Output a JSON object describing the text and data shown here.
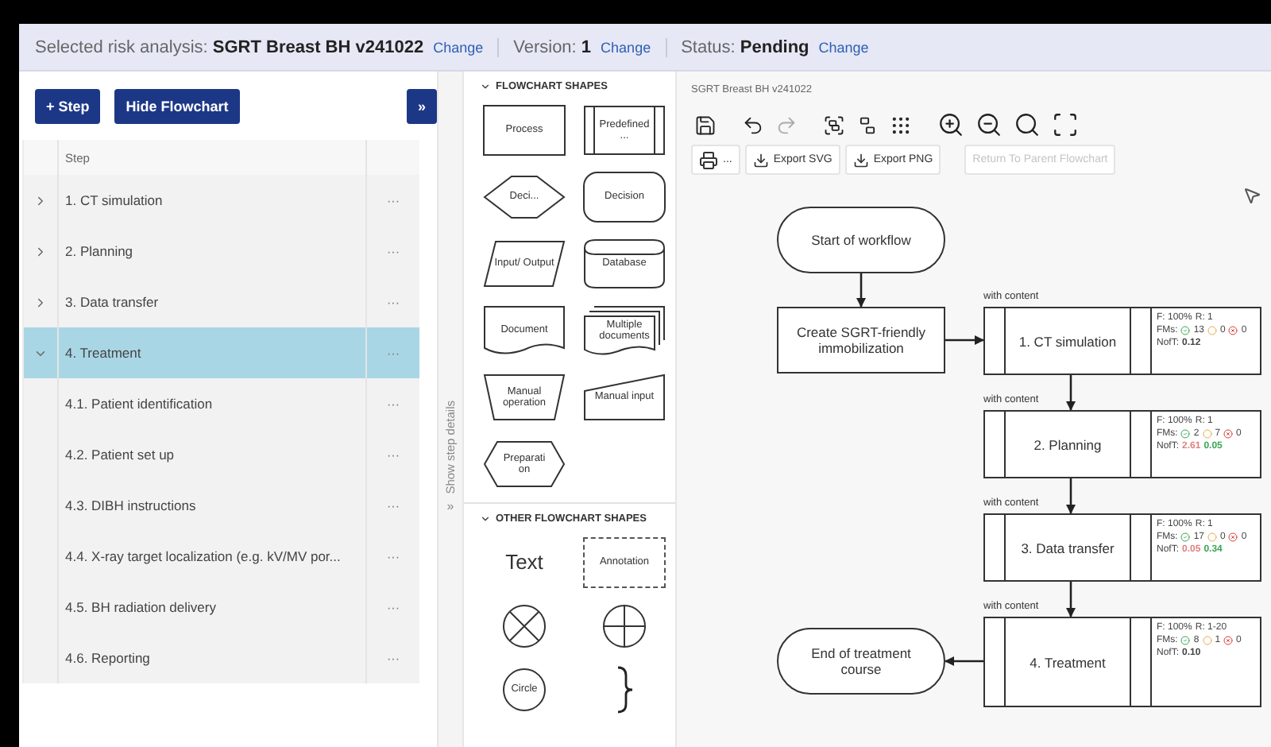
{
  "header": {
    "items": [
      {
        "label": "Selected risk analysis:",
        "value": "SGRT Breast BH v241022",
        "action": "Change"
      },
      {
        "label": "Version:",
        "value": "1",
        "action": "Change"
      },
      {
        "label": "Status:",
        "value": "Pending",
        "action": "Change"
      }
    ]
  },
  "left_panel": {
    "buttons": [
      "+ Step",
      "Hide Flowchart"
    ],
    "collapse_button": "»",
    "table": {
      "columns": [
        "Step"
      ],
      "rows": [
        {
          "label": "1. CT simulation",
          "menu": "···",
          "expanded": false,
          "selected": false
        },
        {
          "label": "2. Planning",
          "menu": "···",
          "expanded": false,
          "selected": false
        },
        {
          "label": "3. Data transfer",
          "menu": "···",
          "expanded": false,
          "selected": false
        },
        {
          "label": "4. Treatment",
          "menu": "···",
          "expanded": true,
          "selected": true,
          "children": [
            {
              "label": "4.1. Patient identification",
              "menu": "···",
              "selected": false
            },
            {
              "label": "4.2. Patient set up",
              "menu": "···",
              "selected": false
            },
            {
              "label": "4.3. DIBH instructions",
              "menu": "···",
              "selected": false
            },
            {
              "label": "4.4. X-ray target localization (e.g. kV/MV por...",
              "menu": "···",
              "selected": false
            },
            {
              "label": "4.5. BH radiation delivery",
              "menu": "···",
              "selected": false
            },
            {
              "label": "4.6. Reporting",
              "menu": "···",
              "selected": false
            }
          ]
        }
      ]
    }
  },
  "details_toggle": {
    "icon": "»",
    "label": "Show step details"
  },
  "shape_sections": [
    {
      "title": "FLOWCHART SHAPES",
      "expanded": true,
      "shapes": [
        {
          "kind": "process",
          "label": "Process"
        },
        {
          "kind": "predefined",
          "label": "Predefined ..."
        },
        {
          "kind": "diamond",
          "label": "Deci..."
        },
        {
          "kind": "rounded",
          "label": "Decision"
        },
        {
          "kind": "parallelogram",
          "label": "Input/ Output"
        },
        {
          "kind": "database",
          "label": "Database"
        },
        {
          "kind": "document",
          "label": "Document"
        },
        {
          "kind": "documents",
          "label": "Multiple documents"
        },
        {
          "kind": "manual_operation",
          "label": "Manual operation"
        },
        {
          "kind": "manual_input",
          "label": "Manual input"
        },
        {
          "kind": "hexagon",
          "label": "Preparation"
        }
      ]
    },
    {
      "title": "OTHER FLOWCHART SHAPES",
      "expanded": true,
      "shapes": [
        {
          "kind": "text",
          "label": "Text"
        },
        {
          "kind": "annotation",
          "label": "Annotation"
        },
        {
          "kind": "x_circle"
        },
        {
          "kind": "plus_circle"
        },
        {
          "kind": "circle",
          "label": "Circle"
        },
        {
          "kind": "brace"
        }
      ]
    }
  ],
  "canvas": {
    "title": "SGRT Breast BH v241022",
    "toolbar": [
      {
        "kind": "save",
        "disabled": false
      },
      {
        "kind": "undo",
        "disabled": false
      },
      {
        "kind": "redo",
        "disabled": true
      },
      {
        "kind": "group",
        "disabled": false
      },
      {
        "kind": "ungroup",
        "disabled": false
      },
      {
        "kind": "grid",
        "disabled": false
      },
      {
        "kind": "zoom_in",
        "disabled": false
      },
      {
        "kind": "zoom_out",
        "disabled": false
      },
      {
        "kind": "zoom_fit",
        "disabled": false
      },
      {
        "kind": "fullscreen",
        "disabled": false
      }
    ],
    "actions": [
      {
        "kind": "print",
        "label": "...",
        "disabled": false
      },
      {
        "kind": "download",
        "label": "Export SVG",
        "disabled": false
      },
      {
        "kind": "download",
        "label": "Export PNG",
        "disabled": false
      },
      {
        "kind": "plain",
        "label": "Return To Parent Flowchart",
        "disabled": true
      }
    ],
    "nodes": [
      {
        "kind": "terminal",
        "label": "Start of workflow"
      },
      {
        "kind": "process",
        "label": "Create SGRT-friendly immobilization"
      },
      {
        "kind": "step",
        "label": "1. CT simulation",
        "note": "with content",
        "f": "F: 100%",
        "r": "R: 1",
        "fms": "FMs:",
        "ok": "13",
        "warn": "0",
        "fail": "0",
        "noft_label": "NofT:",
        "noft": [
          {
            "value": "0.12",
            "color": "#444444"
          }
        ]
      },
      {
        "kind": "step",
        "label": "2. Planning",
        "note": "with content",
        "f": "F: 100%",
        "r": "R: 1",
        "fms": "FMs:",
        "ok": "2",
        "warn": "7",
        "fail": "0",
        "noft_label": "NofT:",
        "noft": [
          {
            "value": "2.61",
            "color": "#e08080"
          },
          {
            "value": "0.05",
            "color": "#3aa655"
          }
        ]
      },
      {
        "kind": "step",
        "label": "3. Data transfer",
        "note": "with content",
        "f": "F: 100%",
        "r": "R: 1",
        "fms": "FMs:",
        "ok": "17",
        "warn": "0",
        "fail": "0",
        "noft_label": "NofT:",
        "noft": [
          {
            "value": "0.05",
            "color": "#e08080"
          },
          {
            "value": "0.34",
            "color": "#3aa655"
          }
        ]
      },
      {
        "kind": "step",
        "label": "4. Treatment",
        "note": "with content",
        "f": "F: 100%",
        "r": "R: 1-20",
        "fms": "FMs:",
        "ok": "8",
        "warn": "1",
        "fail": "0",
        "noft_label": "NofT:",
        "noft": [
          {
            "value": "0.10",
            "color": "#444444"
          }
        ]
      },
      {
        "kind": "terminal",
        "label": "End of treatment course"
      }
    ]
  }
}
